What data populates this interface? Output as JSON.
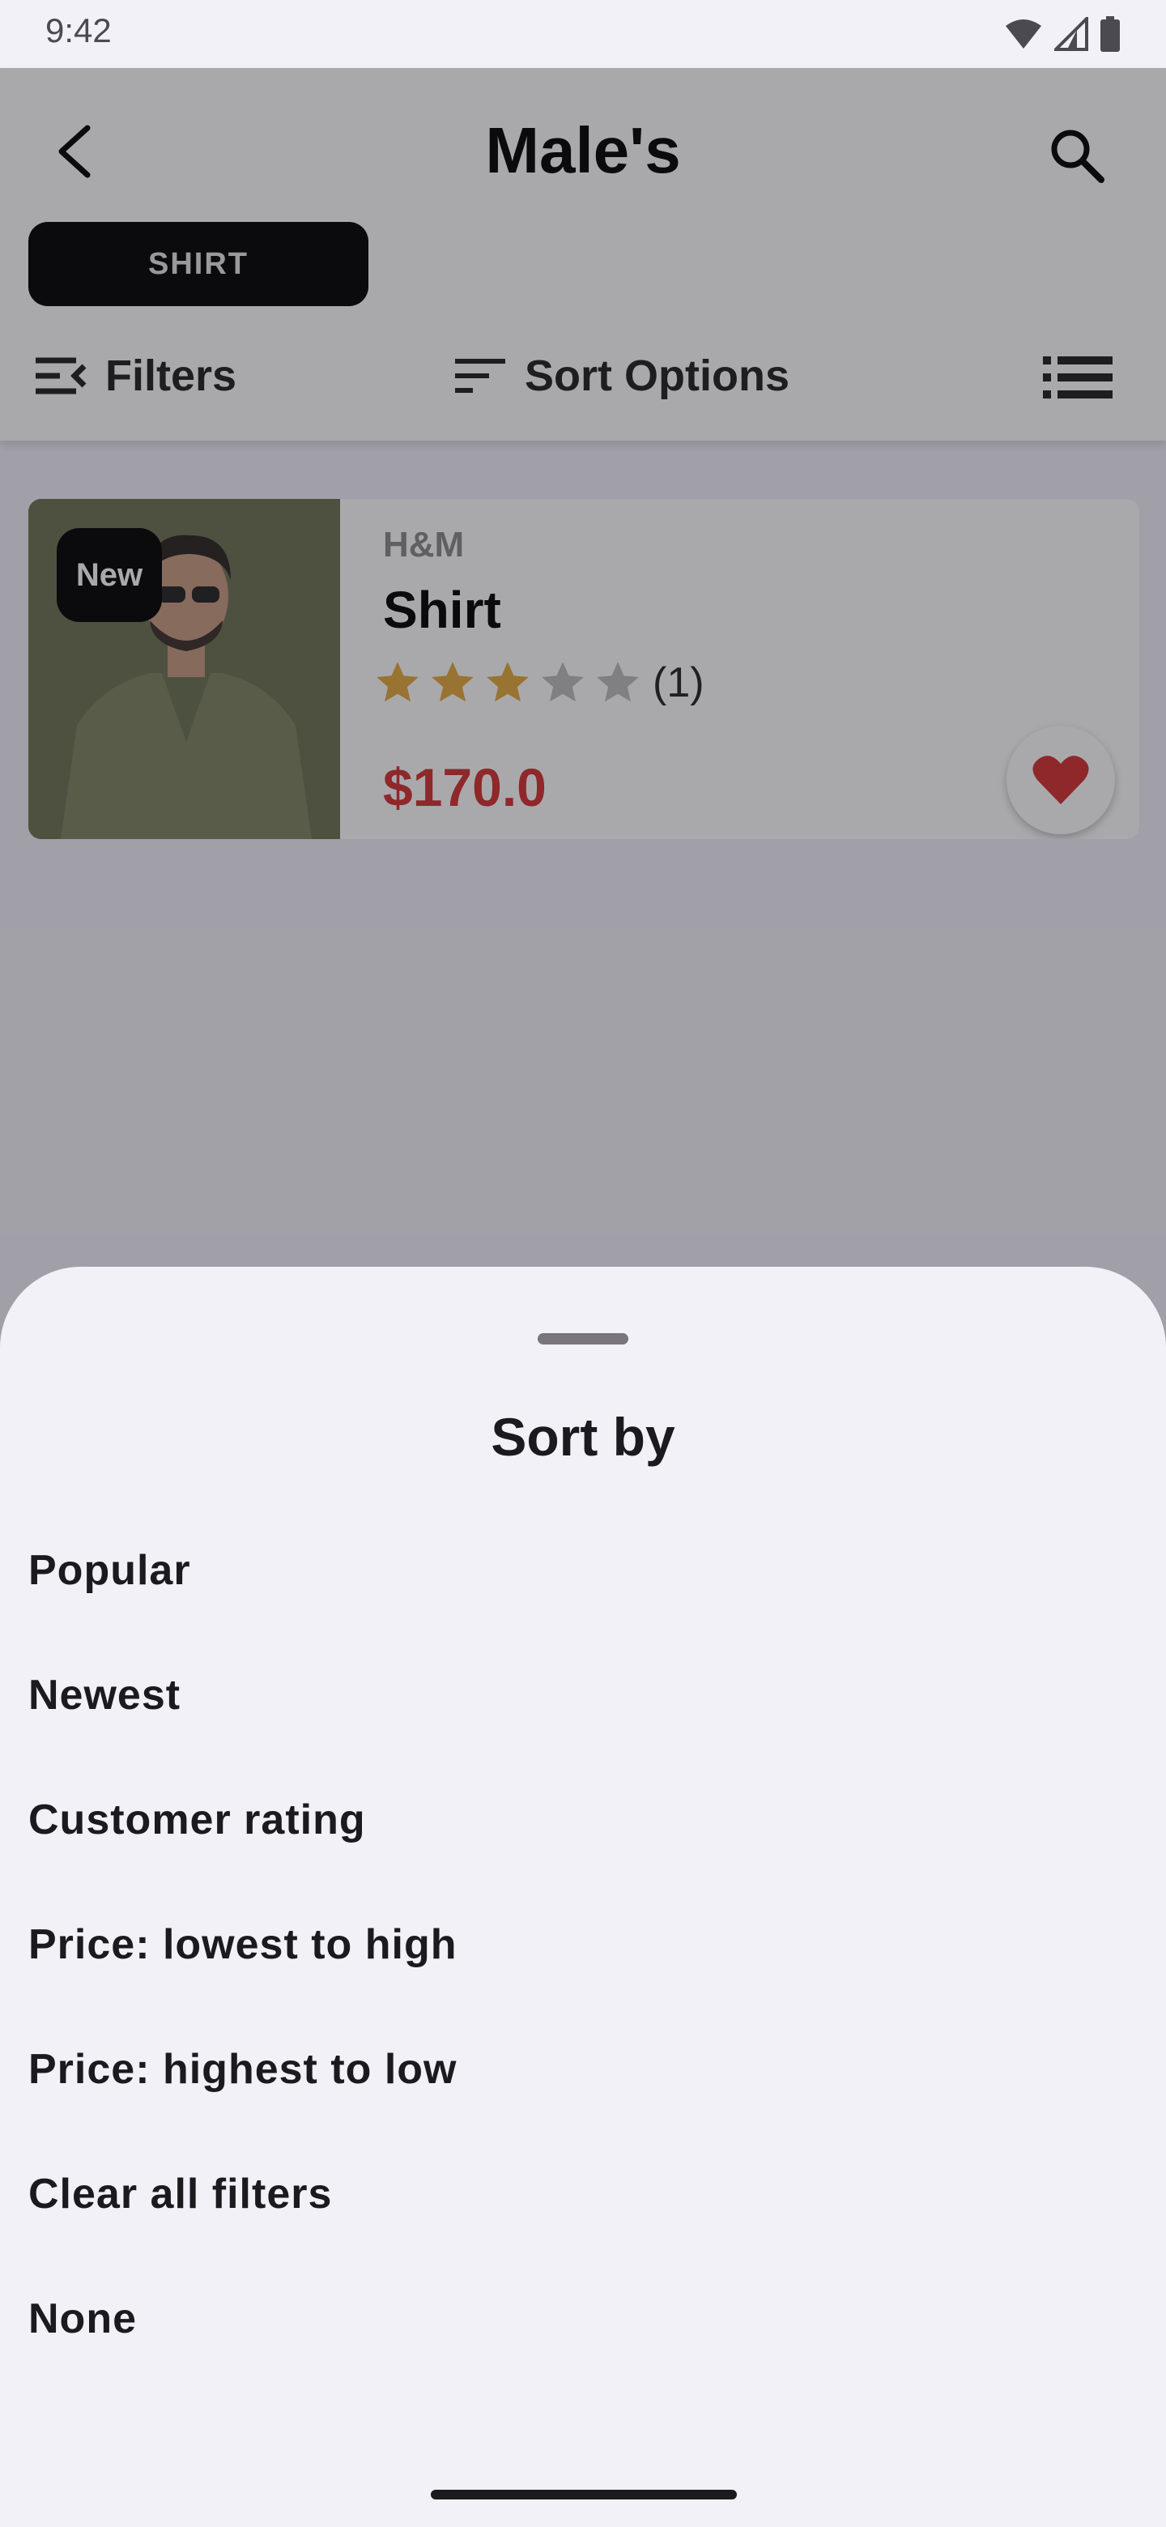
{
  "status_bar": {
    "time": "9:42",
    "icons": [
      "wifi-icon",
      "cell-signal-icon",
      "battery-icon"
    ]
  },
  "header": {
    "title": "Male's",
    "back_icon": "back-arrow-icon",
    "search_icon": "search-icon",
    "chip_label": "SHIRT"
  },
  "toolbar": {
    "filters_label": "Filters",
    "sort_label": "Sort Options",
    "filters_icon": "filter-list-icon",
    "sort_icon": "sort-icon",
    "view_icon": "list-view-icon"
  },
  "product": {
    "badge": "New",
    "brand": "H&M",
    "name": "Shirt",
    "rating": 3,
    "rating_max": 5,
    "rating_count": "(1)",
    "price": "$170.0",
    "favorite_icon": "heart-icon",
    "colors": {
      "price": "#d32f2f",
      "star_filled": "#e5a93a",
      "star_empty": "#bdbdbd",
      "heart": "#d32f2f"
    }
  },
  "sheet": {
    "title": "Sort by",
    "options": [
      "Popular",
      "Newest",
      "Customer rating",
      "Price: lowest to high",
      "Price: highest to low",
      "Clear all filters",
      "None"
    ]
  }
}
